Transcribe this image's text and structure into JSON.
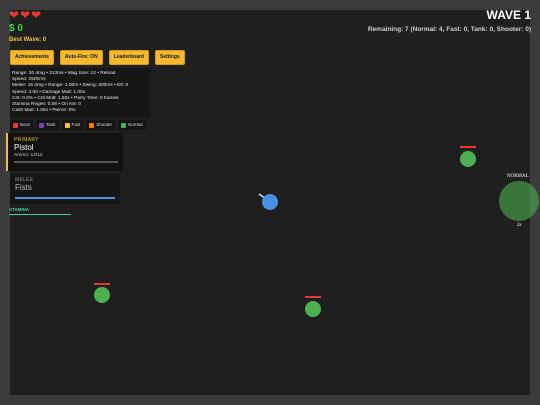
{
  "hud": {
    "hearts": [
      "heart",
      "heart",
      "heart"
    ],
    "cash": "$ 0",
    "best_wave": "Best Wave: 0",
    "wave": "WAVE 1",
    "remaining": "Remaining: 7 (Normal: 4, Fast: 0, Tank: 0, Shooter: 0)"
  },
  "buttons": {
    "achievements": "Achievements",
    "autofire": "Auto-Fire: ON",
    "leaderboard": "Leaderboard",
    "settings": "Settings"
  },
  "stats": {
    "line1": "Range: 30 dmg • 313ms • Mag Size: 12 • Reload",
    "line2": "Speed: 2500ms",
    "line3": "Melee: 15 dmg • Range: 1.00m • Swing: 400ms • Eff: 0",
    "line4": "Speed: 4.00 • Damage Mult: 1.00x",
    "line5": "Crit: 0.0% • Crit Mult: 1.50x • Parry Time: 0 frames",
    "line6": "Stamina Regen: 0.06 • On Kill: 0",
    "line7": "Cash Mult: 1.00x • Pierce: 0%"
  },
  "legend": [
    {
      "label": "Boss",
      "color": "#e53935"
    },
    {
      "label": "Tank",
      "color": "#7b3fb8"
    },
    {
      "label": "Fast",
      "color": "#f5c542"
    },
    {
      "label": "Shooter",
      "color": "#f57c00"
    },
    {
      "label": "Normal",
      "color": "#4caf50"
    }
  ],
  "weapons": {
    "primary_label": "PRIMARY",
    "primary_name": "Pistol",
    "primary_ammo": "Ammo: 12/12",
    "melee_label": "MELEE",
    "melee_name": "Fists"
  },
  "stamina_label": "STAMINA",
  "spawner": {
    "label": "NORMAL",
    "timer": "2s"
  },
  "colors": {
    "accent": "#f5b82e",
    "enemy": "#4caf50",
    "player": "#4a90e2",
    "health": "#e53935"
  }
}
